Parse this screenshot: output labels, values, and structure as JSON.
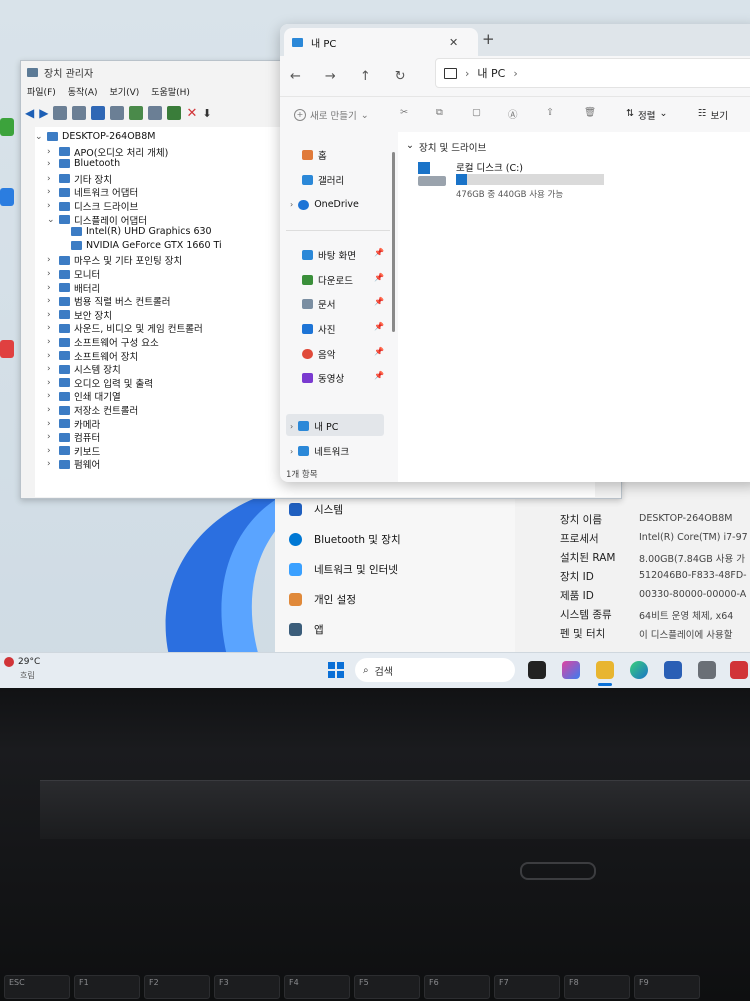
{
  "device_manager": {
    "title": "장치 관리자",
    "menu": [
      "파일(F)",
      "동작(A)",
      "보기(V)",
      "도움말(H)"
    ],
    "tree": [
      {
        "label": "DESKTOP-264OB8M",
        "level": 0,
        "expanded": true
      },
      {
        "label": "APO(오디오 처리 개체)",
        "level": 1
      },
      {
        "label": "Bluetooth",
        "level": 1
      },
      {
        "label": "기타 장치",
        "level": 1
      },
      {
        "label": "네트워크 어댑터",
        "level": 1
      },
      {
        "label": "디스크 드라이브",
        "level": 1
      },
      {
        "label": "디스플레이 어댑터",
        "level": 1,
        "expanded": true
      },
      {
        "label": "Intel(R) UHD Graphics 630",
        "level": 2
      },
      {
        "label": "NVIDIA GeForce GTX 1660 Ti",
        "level": 2
      },
      {
        "label": "마우스 및 기타 포인팅 장치",
        "level": 1
      },
      {
        "label": "모니터",
        "level": 1
      },
      {
        "label": "배터리",
        "level": 1
      },
      {
        "label": "범용 직렬 버스 컨트롤러",
        "level": 1
      },
      {
        "label": "보안 장치",
        "level": 1
      },
      {
        "label": "사운드, 비디오 및 게임 컨트롤러",
        "level": 1
      },
      {
        "label": "소프트웨어 구성 요소",
        "level": 1
      },
      {
        "label": "소프트웨어 장치",
        "level": 1
      },
      {
        "label": "시스템 장치",
        "level": 1
      },
      {
        "label": "오디오 입력 및 출력",
        "level": 1
      },
      {
        "label": "인쇄 대기열",
        "level": 1
      },
      {
        "label": "저장소 컨트롤러",
        "level": 1
      },
      {
        "label": "카메라",
        "level": 1
      },
      {
        "label": "컴퓨터",
        "level": 1
      },
      {
        "label": "키보드",
        "level": 1
      },
      {
        "label": "펌웨어",
        "level": 1
      }
    ]
  },
  "file_explorer": {
    "tab_title": "내 PC",
    "breadcrumb": "내 PC",
    "new_label": "새로 만들기",
    "sort_label": "정렬",
    "view_label": "보기",
    "nav": [
      {
        "label": "홈"
      },
      {
        "label": "갤러리"
      },
      {
        "label": "OneDrive"
      },
      {
        "label": "바탕 화면"
      },
      {
        "label": "다운로드"
      },
      {
        "label": "문서"
      },
      {
        "label": "사진"
      },
      {
        "label": "음악"
      },
      {
        "label": "동영상"
      },
      {
        "label": "내 PC"
      },
      {
        "label": "네트워크"
      }
    ],
    "status": "1개 항목",
    "section": "장치 및 드라이브",
    "drive": {
      "name": "로컬 디스크 (C:)",
      "space": "476GB 중 440GB 사용 가능",
      "used_fraction": 0.076
    }
  },
  "settings": {
    "nav": [
      "시스템",
      "Bluetooth 및 장치",
      "네트워크 및 인터넷",
      "개인 설정",
      "앱"
    ],
    "specs": [
      {
        "label": "장치 이름",
        "value": "DESKTOP-264OB8M"
      },
      {
        "label": "프로세서",
        "value": "Intel(R) Core(TM) i7-97"
      },
      {
        "label": "설치된 RAM",
        "value": "8.00GB(7.84GB 사용 가"
      },
      {
        "label": "장치 ID",
        "value": "512046B0-F833-48FD-"
      },
      {
        "label": "제품 ID",
        "value": "00330-80000-00000-A"
      },
      {
        "label": "시스템 종류",
        "value": "64비트 운영 체제, x64"
      },
      {
        "label": "펜 및 터치",
        "value": "이 디스플레이에 사용할"
      }
    ]
  },
  "taskbar": {
    "weather_temp": "29°C",
    "weather_desc": "흐림",
    "search_label": "검색"
  },
  "keyboard": {
    "keys": [
      "ESC",
      "F1",
      "F2",
      "F3",
      "F4",
      "F5",
      "F6",
      "F7",
      "F8",
      "F9"
    ]
  },
  "colors": {
    "accent": "#0067c0",
    "drive_bar": "#1a73c8",
    "close_red": "#d13438"
  }
}
